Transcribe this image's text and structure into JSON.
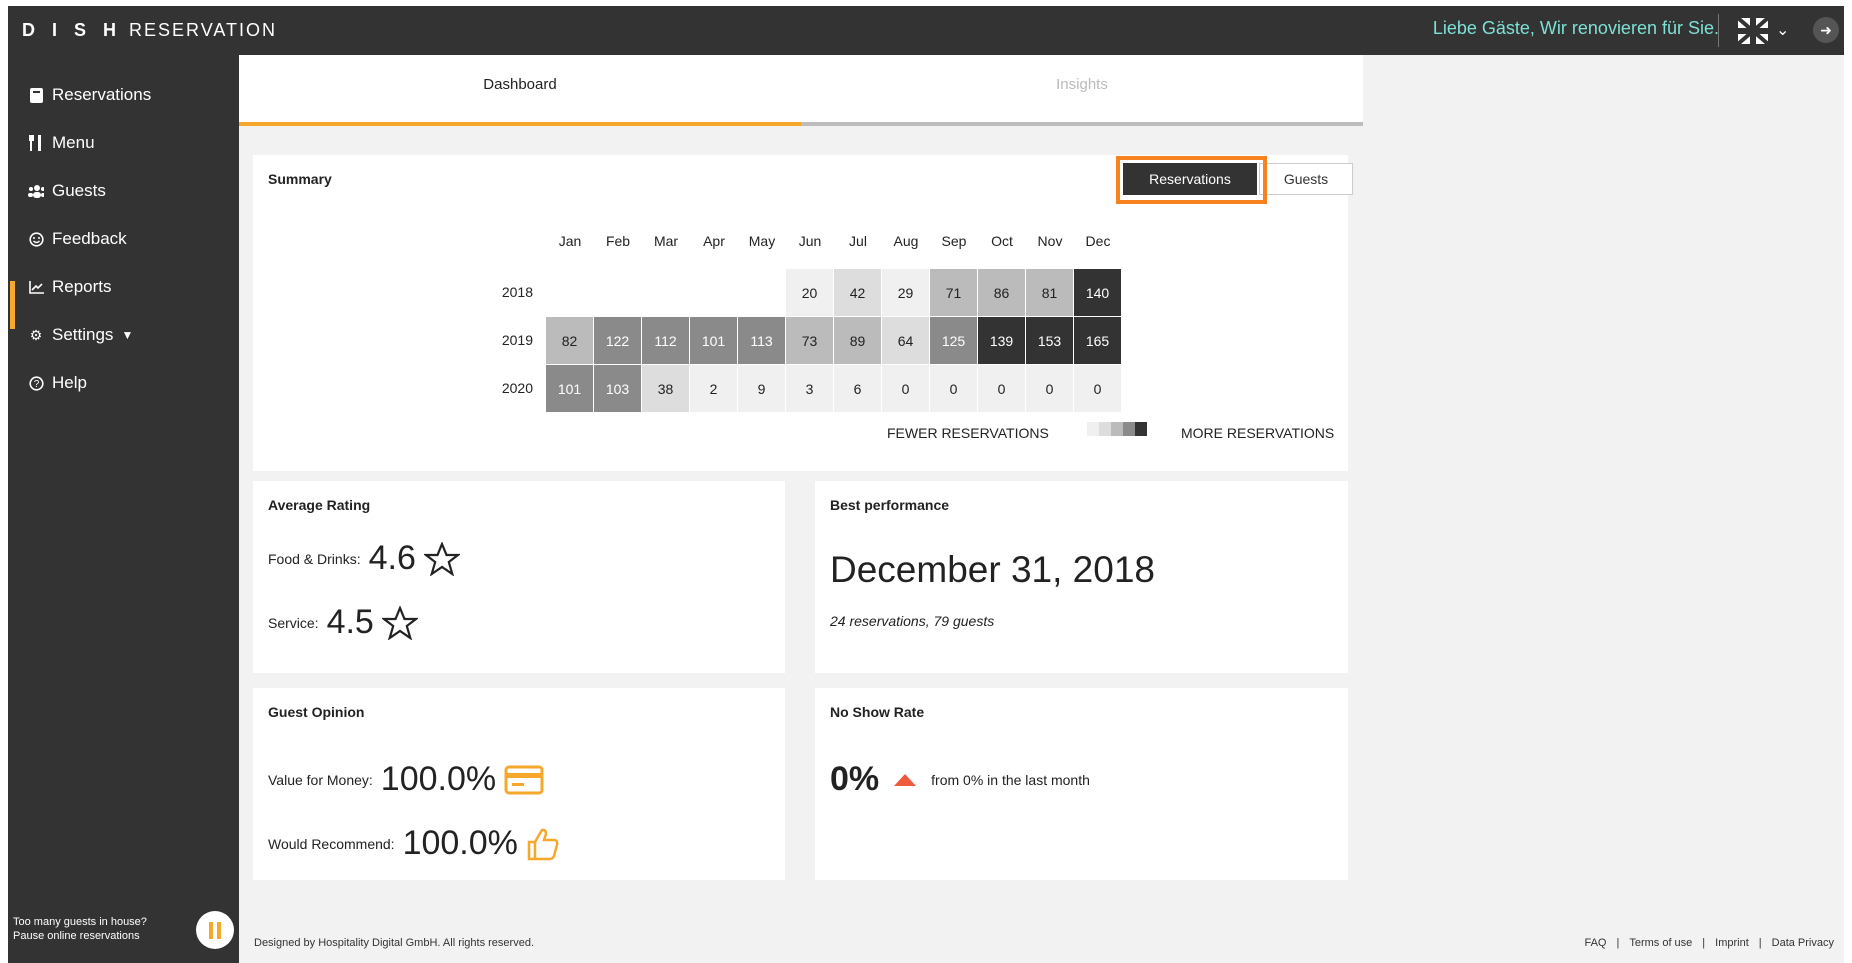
{
  "brand": {
    "name_bold": "D I S H",
    "name_rest": "RESERVATION"
  },
  "topbar": {
    "notice": "Liebe Gäste, Wir renovieren für Sie."
  },
  "sidebar": {
    "items": [
      {
        "label": "Reservations",
        "icon": "book-icon"
      },
      {
        "label": "Menu",
        "icon": "cutlery-icon"
      },
      {
        "label": "Guests",
        "icon": "users-icon"
      },
      {
        "label": "Feedback",
        "icon": "smiley-icon"
      },
      {
        "label": "Reports",
        "icon": "chart-icon"
      },
      {
        "label": "Settings",
        "icon": "gear-icon"
      },
      {
        "label": "Help",
        "icon": "help-icon"
      }
    ],
    "pause_line1": "Too many guests in house?",
    "pause_line2": "Pause online reservations"
  },
  "tabs": {
    "dashboard": "Dashboard",
    "insights": "Insights"
  },
  "summary": {
    "title": "Summary",
    "toggle_reservations": "Reservations",
    "toggle_guests": "Guests",
    "months": [
      "Jan",
      "Feb",
      "Mar",
      "Apr",
      "May",
      "Jun",
      "Jul",
      "Aug",
      "Sep",
      "Oct",
      "Nov",
      "Dec"
    ],
    "years": [
      "2018",
      "2019",
      "2020"
    ],
    "rows": [
      [
        "",
        "",
        "",
        "",
        "",
        "20",
        "42",
        "29",
        "71",
        "86",
        "81",
        "140"
      ],
      [
        "82",
        "122",
        "112",
        "101",
        "113",
        "73",
        "89",
        "64",
        "125",
        "139",
        "153",
        "165"
      ],
      [
        "101",
        "103",
        "38",
        "2",
        "9",
        "3",
        "6",
        "0",
        "0",
        "0",
        "0",
        "0"
      ]
    ],
    "legend_fewer": "FEWER RESERVATIONS",
    "legend_more": "MORE RESERVATIONS",
    "scale_colors": [
      "#f0f0f0",
      "#dddddd",
      "#bbbbbb",
      "#8a8a8a",
      "#333333"
    ]
  },
  "rating": {
    "title": "Average Rating",
    "food_label": "Food & Drinks:",
    "food_value": "4.6",
    "service_label": "Service:",
    "service_value": "4.5"
  },
  "best": {
    "title": "Best performance",
    "date": "December 31, 2018",
    "detail": "24 reservations, 79 guests"
  },
  "opinion": {
    "title": "Guest Opinion",
    "value_label": "Value for Money:",
    "value_value": "100.0%",
    "recommend_label": "Would Recommend:",
    "recommend_value": "100.0%"
  },
  "noshow": {
    "title": "No Show Rate",
    "value": "0%",
    "detail": "from 0% in the last month"
  },
  "footer": {
    "copyright": "Designed by Hospitality Digital GmbH. All rights reserved.",
    "links": [
      "FAQ",
      "Terms of use",
      "Imprint",
      "Data Privacy"
    ]
  },
  "colors": {
    "accent": "#f6a82d",
    "highlight": "#f6831f",
    "dark": "#333333",
    "notice": "#7ee1d6",
    "noshow_arrow": "#f05a3c"
  }
}
